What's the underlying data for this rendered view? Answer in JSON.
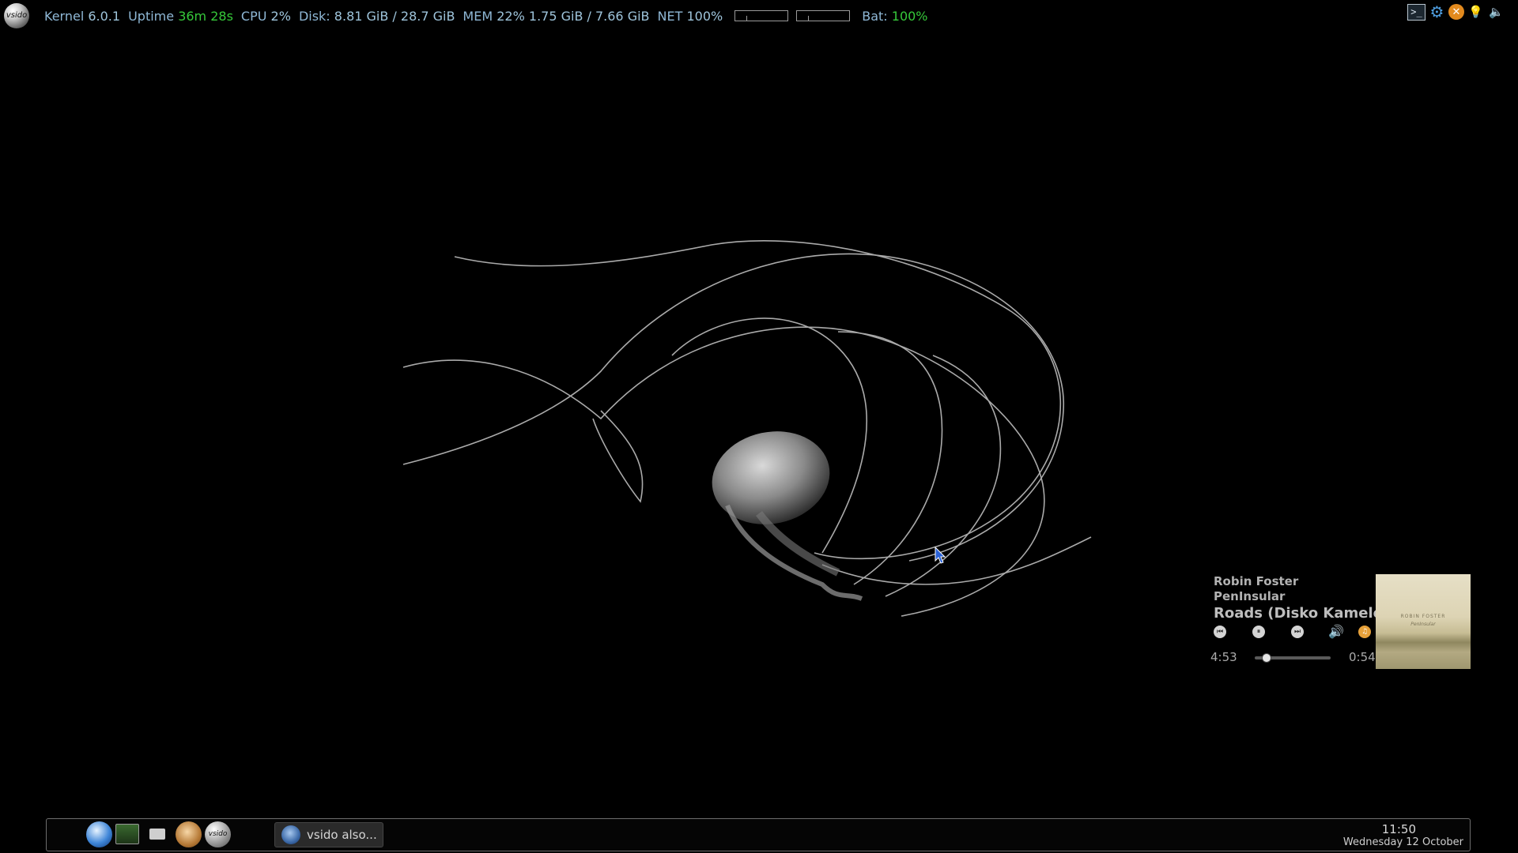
{
  "topbar": {
    "logo_text": "vsido",
    "kernel_label": "Kernel",
    "kernel_value": "6.0.1",
    "uptime_label": "Uptime",
    "uptime_value": "36m 28s",
    "cpu_label": "CPU",
    "cpu_value": "2%",
    "disk_label": "Disk:",
    "disk_value": "8.81 GiB / 28.7 GiB",
    "mem_label": "MEM",
    "mem_value": "22% 1.75 GiB / 7.66 GiB",
    "net_label": "NET",
    "net_value": "100%",
    "bat_label": "Bat:",
    "bat_value": "100%"
  },
  "tray": {
    "terminal_glyph": ">_",
    "settings_glyph": "⚙",
    "close_glyph": "✕",
    "bulb_glyph": "💡",
    "volume_glyph": "🔈"
  },
  "player": {
    "artist": "Robin Foster",
    "album": "PenInsular",
    "song": "Roads (Disko Kameleon",
    "elapsed": "4:53",
    "remaining": "0:54",
    "progress": 0.15,
    "art_title": "ROBIN FOSTER",
    "art_subtitle": "PenInsular",
    "prev_glyph": "⏮",
    "pause_glyph": "⏸",
    "next_glyph": "⏭",
    "volume_glyph": "🔊",
    "extra_glyph": "♫"
  },
  "panel": {
    "launcher_vsido_text": "vsido",
    "task_label": "vsido also...",
    "clock_time": "11:50",
    "clock_date": "Wednesday 12 October"
  },
  "colors": {
    "accent_green": "#36c93a",
    "label_blue": "#8fb8d6",
    "background": "#000000"
  }
}
